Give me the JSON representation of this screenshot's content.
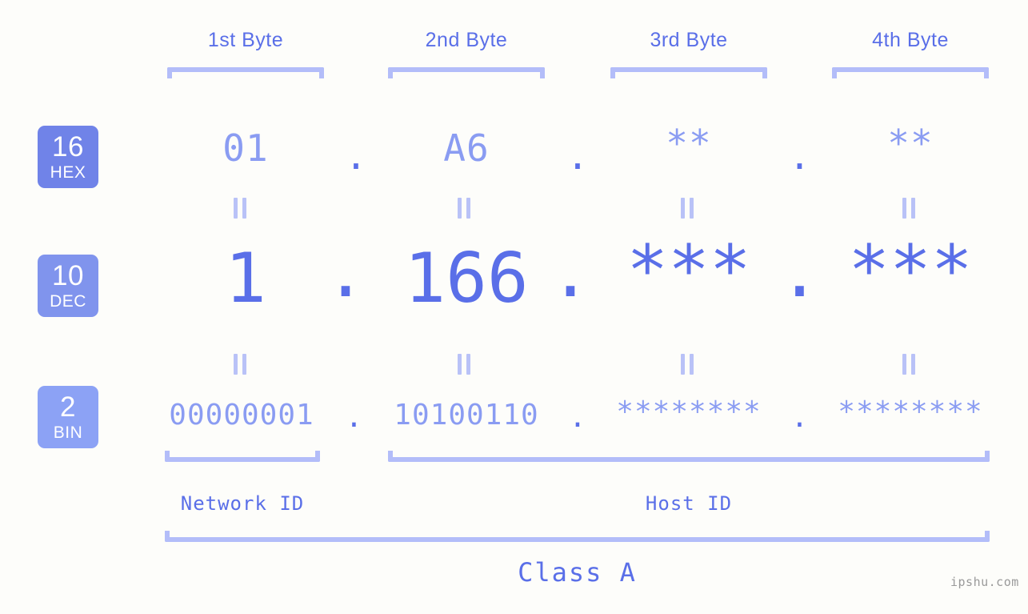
{
  "page": {
    "background": "#fdfdfa",
    "accent": "#5a6fe8",
    "accent_light": "#8a9cf2",
    "accent_pale": "#b3bdf9"
  },
  "headers": [
    {
      "label": "1st Byte"
    },
    {
      "label": "2nd Byte"
    },
    {
      "label": "3rd Byte"
    },
    {
      "label": "4th Byte"
    }
  ],
  "bases": [
    {
      "num": "16",
      "name": "HEX",
      "color": "#7083e8"
    },
    {
      "num": "10",
      "name": "DEC",
      "color": "#8094ed"
    },
    {
      "num": "2",
      "name": "BIN",
      "color": "#8ca2f5"
    }
  ],
  "rows": {
    "hex": {
      "values": [
        "01",
        "A6",
        "**",
        "**"
      ],
      "separator": "."
    },
    "dec": {
      "values": [
        "1",
        "166",
        "***",
        "***"
      ],
      "separator": "."
    },
    "bin": {
      "values": [
        "00000001",
        "10100110",
        "********",
        "********"
      ],
      "separator": "."
    }
  },
  "connector": {
    "symbol": "="
  },
  "sections": {
    "network_id": "Network ID",
    "host_id": "Host ID",
    "class": "Class A"
  },
  "watermark": "ipshu.com"
}
